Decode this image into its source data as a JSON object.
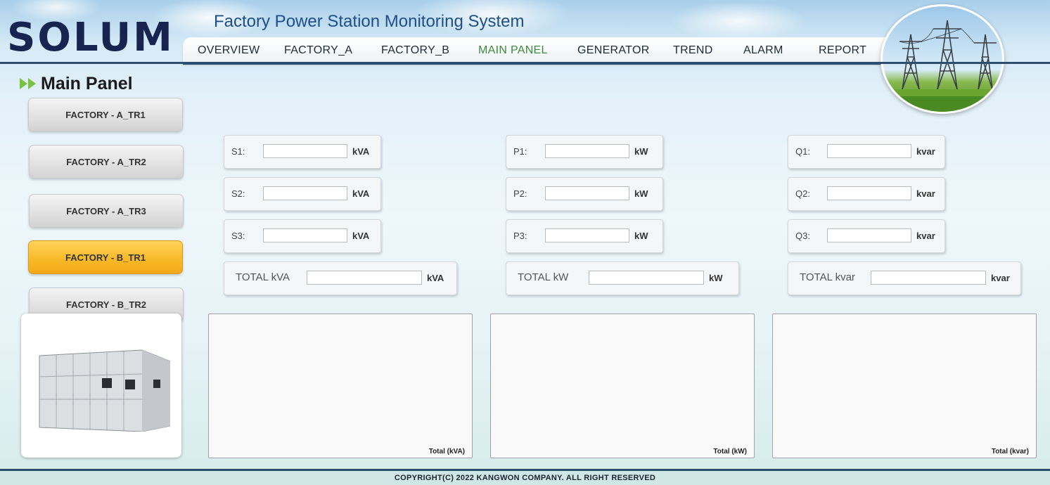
{
  "header": {
    "logo": "SOLUM",
    "app_title": "Factory Power Station Monitoring System"
  },
  "nav": {
    "items": [
      "OVERVIEW",
      "FACTORY_A",
      "FACTORY_B",
      "MAIN PANEL",
      "GENERATOR",
      "TREND",
      "ALARM",
      "REPORT"
    ],
    "active": "MAIN PANEL"
  },
  "sidebar": {
    "title": "Main Panel",
    "buttons": [
      {
        "label": "FACTORY - A_TR1",
        "active": false
      },
      {
        "label": "FACTORY - A_TR2",
        "active": false
      },
      {
        "label": "FACTORY - A_TR3",
        "active": false
      },
      {
        "label": "FACTORY - B_TR1",
        "active": true
      },
      {
        "label": "FACTORY - B_TR2",
        "active": false
      }
    ]
  },
  "apparent": {
    "fields": [
      {
        "label": "S1:",
        "value": "",
        "unit": "kVA"
      },
      {
        "label": "S2:",
        "value": "",
        "unit": "kVA"
      },
      {
        "label": "S3:",
        "value": "",
        "unit": "kVA"
      }
    ],
    "total": {
      "label": "TOTAL kVA",
      "value": "",
      "unit": "kVA"
    },
    "chart_caption": "Total (kVA)"
  },
  "active_power": {
    "fields": [
      {
        "label": "P1:",
        "value": "",
        "unit": "kW"
      },
      {
        "label": "P2:",
        "value": "",
        "unit": "kW"
      },
      {
        "label": "P3:",
        "value": "",
        "unit": "kW"
      }
    ],
    "total": {
      "label": "TOTAL kW",
      "value": "",
      "unit": "kW"
    },
    "chart_caption": "Total (kW)"
  },
  "reactive": {
    "fields": [
      {
        "label": "Q1:",
        "value": "",
        "unit": "kvar"
      },
      {
        "label": "Q2:",
        "value": "",
        "unit": "kvar"
      },
      {
        "label": "Q3:",
        "value": "",
        "unit": "kvar"
      }
    ],
    "total": {
      "label": "TOTAL kvar",
      "value": "",
      "unit": "kvar"
    },
    "chart_caption": "Total (kvar)"
  },
  "footer": {
    "copyright": "COPYRIGHT(C) 2022 KANGWON COMPANY. ALL RIGHT RESERVED"
  },
  "colors": {
    "nav_active": "#3e8a3e",
    "button_active": "#f8b826",
    "rule": "#2d4e6e",
    "logo": "#16244f"
  }
}
